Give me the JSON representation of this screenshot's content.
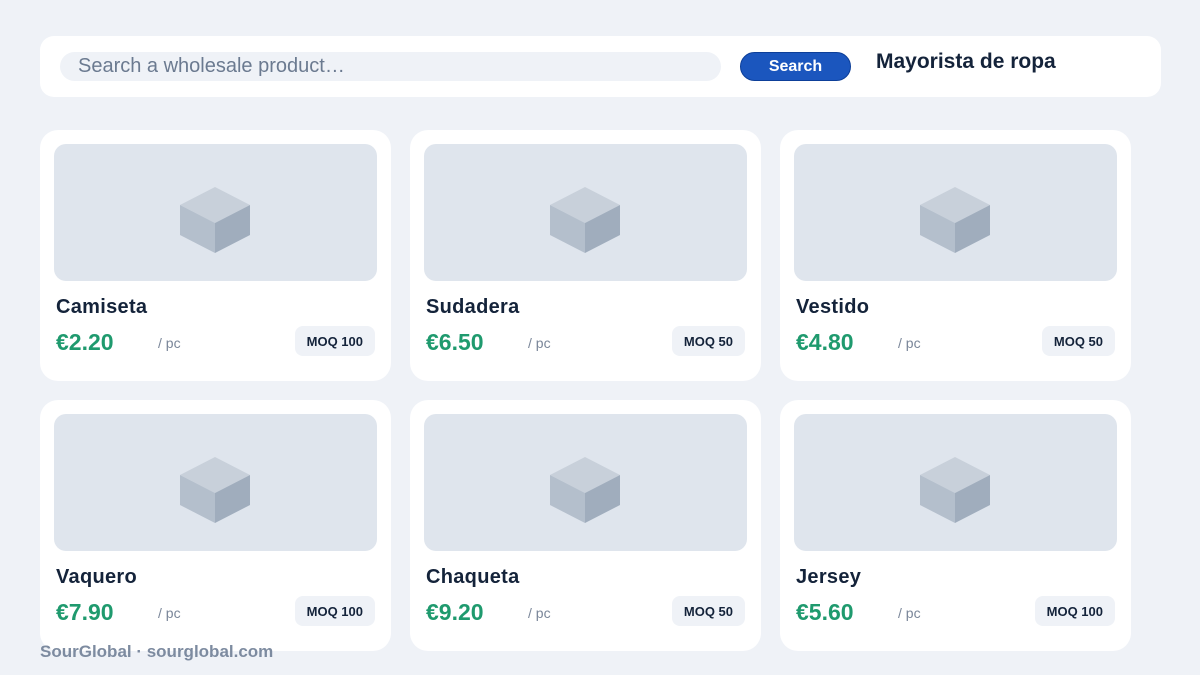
{
  "search": {
    "placeholder": "Search a wholesale product…",
    "button_label": "Search"
  },
  "header": {
    "title": "Mayorista de ropa"
  },
  "products": [
    {
      "name": "Camiseta",
      "price": "€2.20",
      "unit": "/ pc",
      "moq": "MOQ 100",
      "icon": "box-icon"
    },
    {
      "name": "Sudadera",
      "price": "€6.50",
      "unit": "/ pc",
      "moq": "MOQ 50",
      "icon": "box-icon"
    },
    {
      "name": "Vestido",
      "price": "€4.80",
      "unit": "/ pc",
      "moq": "MOQ 50",
      "icon": "box-icon"
    },
    {
      "name": "Vaquero",
      "price": "€7.90",
      "unit": "/ pc",
      "moq": "MOQ 100",
      "icon": "box-icon"
    },
    {
      "name": "Chaqueta",
      "price": "€9.20",
      "unit": "/ pc",
      "moq": "MOQ 50",
      "icon": "box-icon"
    },
    {
      "name": "Jersey",
      "price": "€5.60",
      "unit": "/ pc",
      "moq": "MOQ 100",
      "icon": "box-icon"
    }
  ],
  "footer": {
    "text": "SourGlobal · sourglobal.com"
  },
  "colors": {
    "accent": "#1b56be",
    "price": "#1f9a6e",
    "background": "#eff2f7"
  }
}
